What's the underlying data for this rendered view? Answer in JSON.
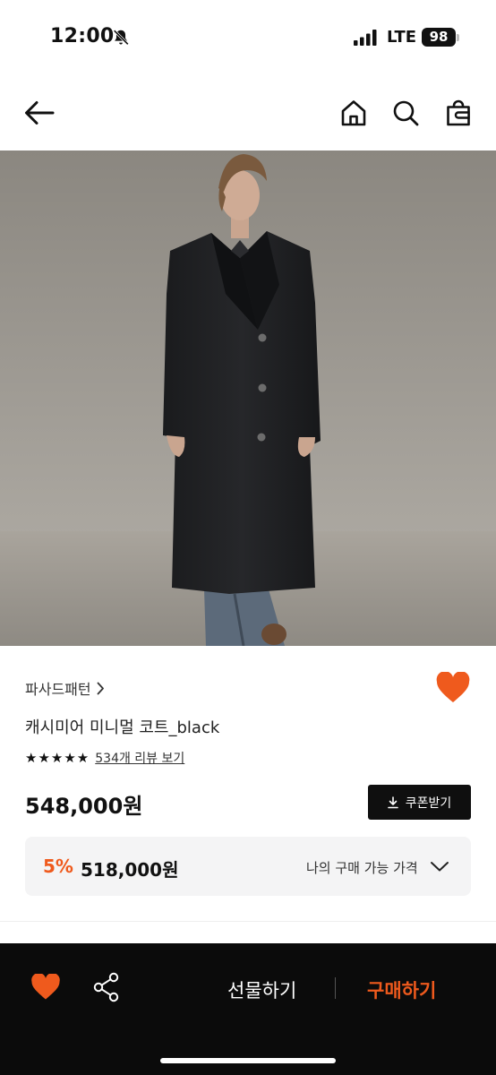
{
  "status_bar": {
    "time": "12:00",
    "network": "LTE",
    "battery": "98",
    "icons": [
      "bell-slash-icon",
      "cellular-signal-icon",
      "battery-icon"
    ]
  },
  "nav": {
    "icons": [
      "back-arrow-icon",
      "home-icon",
      "search-icon",
      "shopping-bag-icon"
    ]
  },
  "product": {
    "brand": "파사드패턴",
    "name": "캐시미어 미니멀 코트_black",
    "rating_stars": "★★★★★",
    "rating_value": 5,
    "review_link": "534개 리뷰 보기",
    "price": "548,000원",
    "coupon_label": "쿠폰받기",
    "discount": {
      "rate": "5%",
      "price": "518,000원",
      "label": "나의 구매 가능 가격"
    }
  },
  "bottom_bar": {
    "gift_label": "선물하기",
    "buy_label": "구매하기"
  },
  "colors": {
    "accent": "#ef5a1d",
    "bottom_bar_bg": "#0b0b0b",
    "discount_box_bg": "#f4f4f5",
    "coupon_bg": "#0f0f0f"
  }
}
